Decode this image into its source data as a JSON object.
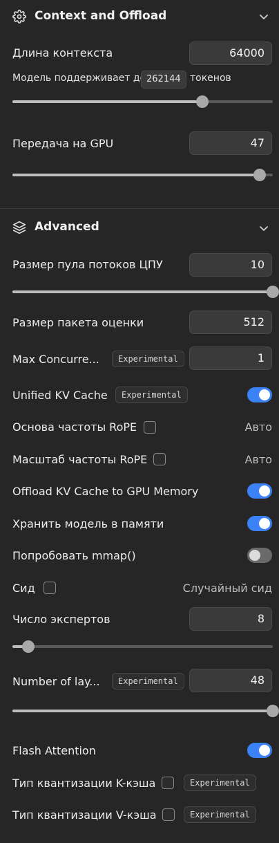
{
  "context": {
    "title": "Context and Offload",
    "context_length_label": "Длина контекста",
    "context_length_value": "64000",
    "model_supports_prefix": "Модель поддерживает до",
    "model_supports_value": "262144",
    "model_supports_suffix": "токенов",
    "context_slider_level": 0.73,
    "gpu_offload_label": "Передача на GPU",
    "gpu_offload_value": "47",
    "gpu_slider_level": 0.95
  },
  "advanced": {
    "title": "Advanced",
    "thread_pool_label": "Размер пула потоков ЦПУ",
    "thread_pool_value": "10",
    "thread_slider_level": 1.0,
    "batch_size_label": "Размер пакета оценки",
    "batch_size_value": "512",
    "max_concurrent_label": "Max Concurre...",
    "max_concurrent_badge": "Experimental",
    "max_concurrent_value": "1",
    "unified_kv_label": "Unified KV Cache",
    "unified_kv_badge": "Experimental",
    "unified_kv_on": true,
    "rope_base_label": "Основа частоты RoPE",
    "rope_base_value": "Авто",
    "rope_scale_label": "Масштаб частоты RoPE",
    "rope_scale_value": "Авто",
    "offload_kv_label": "Offload KV Cache to GPU Memory",
    "offload_kv_on": true,
    "keep_in_memory_label": "Хранить модель в памяти",
    "keep_in_memory_on": true,
    "mmap_label": "Попробовать mmap()",
    "mmap_on": false,
    "seed_label": "Сид",
    "seed_value": "Случайный сид",
    "experts_label": "Число экспертов",
    "experts_value": "8",
    "experts_slider_level": 0.06,
    "layers_label": "Number of lay...",
    "layers_badge": "Experimental",
    "layers_value": "48",
    "layers_slider_level": 1.0,
    "flash_attention_label": "Flash Attention",
    "flash_attention_on": true,
    "k_cache_label": "Тип квантизации K-кэша",
    "k_cache_badge": "Experimental",
    "v_cache_label": "Тип квантизации V-кэша",
    "v_cache_badge": "Experimental"
  },
  "colors": {
    "accent": "#3b82f6",
    "background": "#262626",
    "input": "#3a3a3a"
  },
  "icons": {
    "context": "gear-icon",
    "advanced": "layers-icon",
    "collapse": "chevron-down-icon"
  }
}
